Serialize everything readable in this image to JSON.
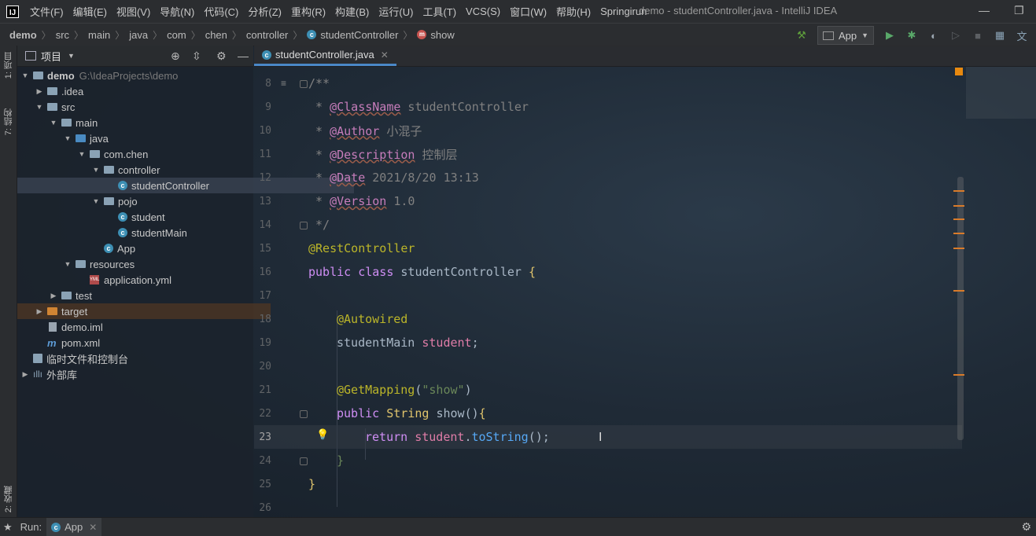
{
  "menu": {
    "items": [
      "文件(F)",
      "编辑(E)",
      "视图(V)",
      "导航(N)",
      "代码(C)",
      "分析(Z)",
      "重构(R)",
      "构建(B)",
      "运行(U)",
      "工具(T)",
      "VCS(S)",
      "窗口(W)",
      "帮助(H)",
      "Springirun"
    ],
    "window_title": "demo - studentController.java - IntelliJ IDEA"
  },
  "breadcrumb": {
    "items": [
      "demo",
      "src",
      "main",
      "java",
      "com",
      "chen",
      "controller",
      "studentController",
      "show"
    ]
  },
  "toolbar": {
    "run_config": "App"
  },
  "left_strip": {
    "project_tab": "1: 项目",
    "structure_tab": "7: 结构",
    "favorites_tab": "2: 收藏"
  },
  "project_panel": {
    "title": "项目",
    "tree": [
      {
        "label": "demo",
        "extra": "G:\\IdeaProjects\\demo"
      },
      {
        "label": ".idea"
      },
      {
        "label": "src"
      },
      {
        "label": "main"
      },
      {
        "label": "java"
      },
      {
        "label": "com.chen"
      },
      {
        "label": "controller"
      },
      {
        "label": "studentController"
      },
      {
        "label": "pojo"
      },
      {
        "label": "student"
      },
      {
        "label": "studentMain"
      },
      {
        "label": "App"
      },
      {
        "label": "resources"
      },
      {
        "label": "application.yml"
      },
      {
        "label": "test"
      },
      {
        "label": "target"
      },
      {
        "label": "demo.iml"
      },
      {
        "label": "pom.xml"
      },
      {
        "label": "临时文件和控制台"
      },
      {
        "label": "外部库"
      }
    ]
  },
  "editor": {
    "tab_title": "studentController.java",
    "line_numbers": [
      "8",
      "9",
      "10",
      "11",
      "12",
      "13",
      "14",
      "15",
      "16",
      "17",
      "18",
      "19",
      "20",
      "21",
      "22",
      "23",
      "24",
      "25",
      "26"
    ],
    "doc": {
      "open": "/**",
      "star": " * ",
      "classname_tag": "@ClassName",
      "classname_val": " studentController",
      "author_tag": "@Author",
      "author_val": " 小混子",
      "desc_tag": "@Description",
      "desc_val": " 控制层",
      "date_tag": "@Date",
      "date_val": " 2021/8/20 13:13",
      "version_tag": "@Version",
      "version_val": " 1.0",
      "close": " */"
    },
    "code": {
      "rest_controller": "@RestController",
      "public": "public",
      "class": "class",
      "class_name": "studentController",
      "open_brace": "{",
      "autowired": "@Autowired",
      "field_type": "studentMain",
      "field_name": "student",
      "semicolon": ";",
      "get_mapping": "@GetMapping",
      "paren_open": "(",
      "mapping_value": "\"show\"",
      "paren_close": ")",
      "return_type": "String",
      "method_name": "show",
      "method_parens": "()",
      "return": "return",
      "dot": ".",
      "to_string": "toString",
      "call_end": "();",
      "close_brace": "}"
    }
  },
  "bottom": {
    "run_label": "Run:",
    "run_tab": "App"
  }
}
